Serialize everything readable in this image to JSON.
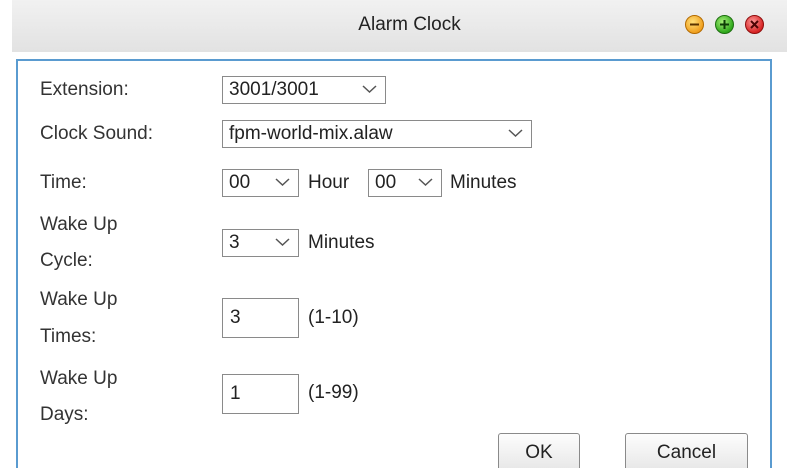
{
  "window": {
    "title": "Alarm Clock",
    "controls": {
      "minimize_icon": "minimize-icon",
      "maximize_icon": "maximize-icon",
      "close_icon": "close-icon"
    }
  },
  "form": {
    "extension": {
      "label": "Extension:",
      "value": "3001/3001"
    },
    "clock_sound": {
      "label": "Clock Sound:",
      "value": "fpm-world-mix.alaw"
    },
    "time": {
      "label": "Time:",
      "hour_value": "00",
      "hour_unit": "Hour",
      "minute_value": "00",
      "minute_unit": "Minutes"
    },
    "wake_up_cycle": {
      "label_line1": "Wake Up",
      "label_line2": "Cycle:",
      "value": "3",
      "unit": "Minutes"
    },
    "wake_up_times": {
      "label_line1": "Wake Up",
      "label_line2": "Times:",
      "value": "3",
      "range": "(1-10)"
    },
    "wake_up_days": {
      "label_line1": "Wake Up",
      "label_line2": "Days:",
      "value": "1",
      "range": "(1-99)"
    }
  },
  "buttons": {
    "ok": "OK",
    "cancel": "Cancel"
  },
  "colors": {
    "panel_border": "#5a9bd0",
    "minimize": "#f0a020",
    "maximize": "#2fa81c",
    "close": "#d72424"
  }
}
